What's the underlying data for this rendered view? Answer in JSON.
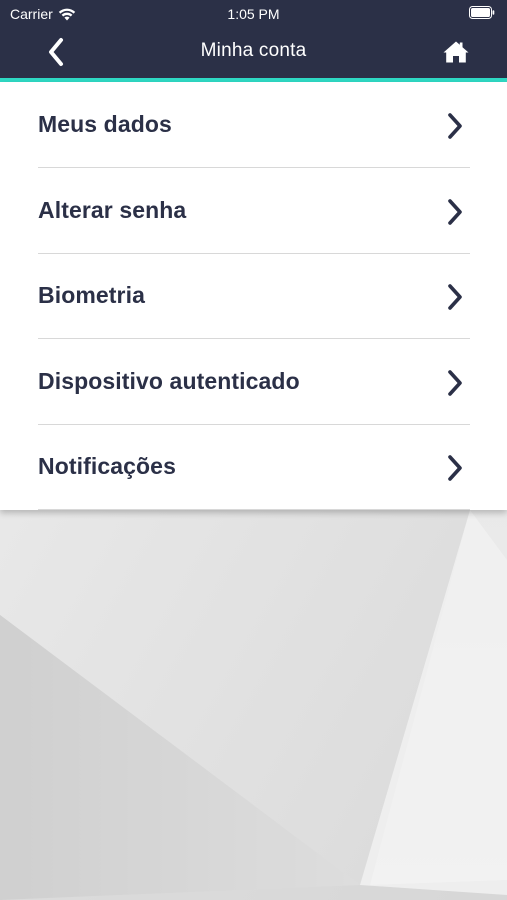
{
  "status_bar": {
    "carrier": "Carrier",
    "time": "1:05 PM",
    "wifi_icon": "wifi-icon",
    "battery_icon": "battery-icon"
  },
  "nav": {
    "title": "Minha conta",
    "back_icon": "chevron-left-icon",
    "home_icon": "home-icon"
  },
  "menu": {
    "items": [
      {
        "label": "Meus dados",
        "icon": "chevron-right-icon"
      },
      {
        "label": "Alterar senha",
        "icon": "chevron-right-icon"
      },
      {
        "label": "Biometria",
        "icon": "chevron-right-icon"
      },
      {
        "label": "Dispositivo autenticado",
        "icon": "chevron-right-icon"
      },
      {
        "label": "Notificações",
        "icon": "chevron-right-icon"
      }
    ]
  },
  "colors": {
    "nav_background": "#2b3047",
    "accent": "#2fd9c4",
    "text": "#2b3047",
    "divider": "#d8d8d8"
  }
}
